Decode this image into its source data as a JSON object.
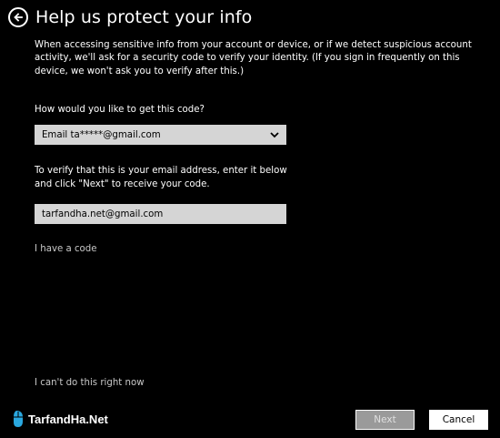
{
  "header": {
    "title": "Help us protect your info",
    "back_icon": "back-arrow-icon"
  },
  "description": "When accessing sensitive info from your account or device, or if we detect suspicious account activity, we'll ask for a security code to verify your identity. (If you sign in frequently on this device, we won't ask you to verify after this.)",
  "method": {
    "question": "How would you like to get this code?",
    "selected": "Email ta*****@gmail.com",
    "dropdown_icon": "chevron-down-icon"
  },
  "verify": {
    "instruction_line1": "To verify that this is your email address, enter it below",
    "instruction_line2": "and click \"Next\" to receive your code.",
    "email_value": "tarfandha.net@gmail.com"
  },
  "links": {
    "have_code": "I have a code",
    "cant_do": "I can't do this right now"
  },
  "watermark": {
    "text": "TarfandHa.Net",
    "icon": "mouse-icon"
  },
  "buttons": {
    "next": "Next",
    "cancel": "Cancel"
  },
  "colors": {
    "background": "#000000",
    "field": "#d5d5d5",
    "next_disabled": "#9a9a9a",
    "link": "#c8c8c8"
  }
}
